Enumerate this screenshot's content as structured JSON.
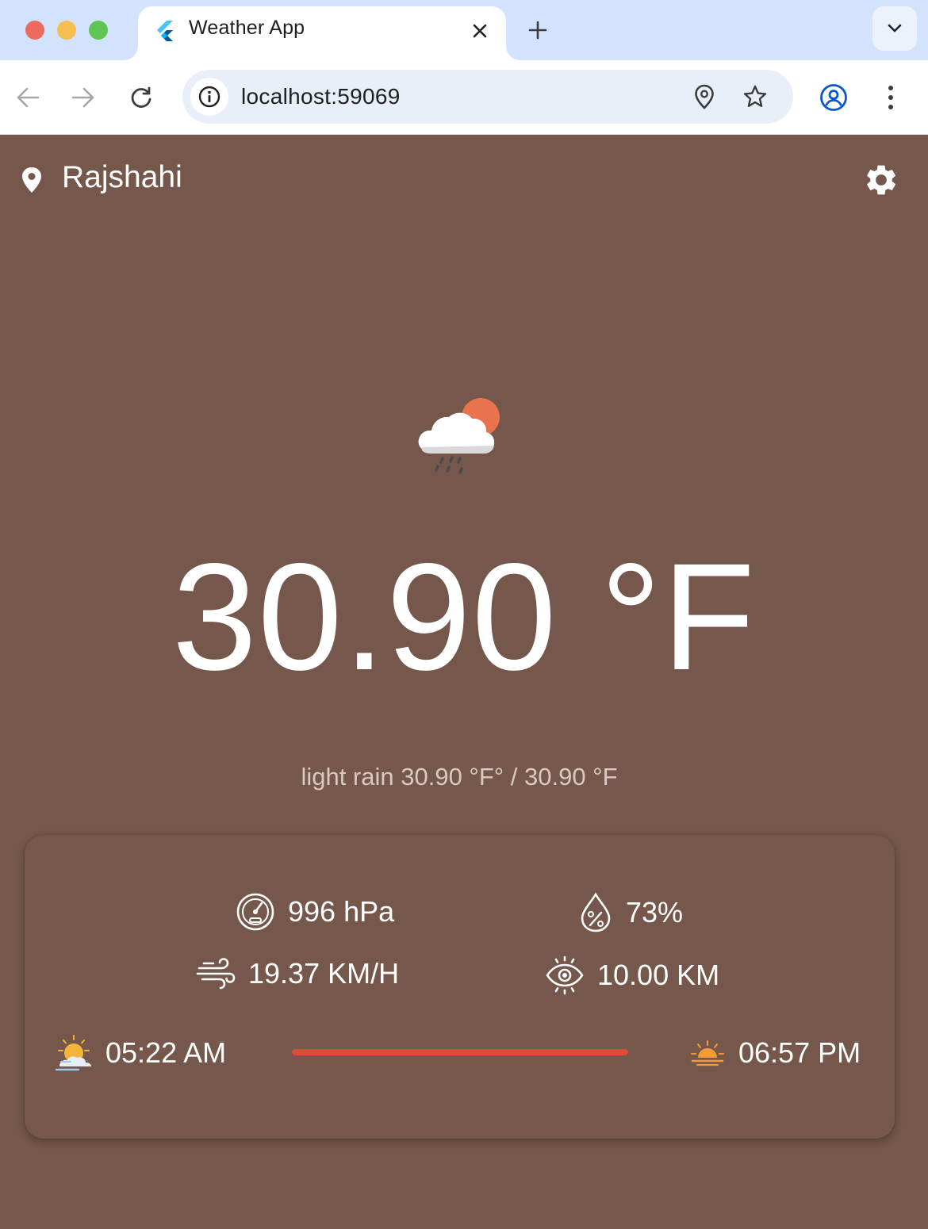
{
  "browser": {
    "tab_title": "Weather App",
    "url": "localhost:59069"
  },
  "header": {
    "city": "Rajshahi"
  },
  "weather": {
    "icon": "cloud-sun-rain-icon",
    "temperature": "30.90 °F",
    "description": "light rain 30.90 °F° / 30.90 °F"
  },
  "details": {
    "pressure": "996 hPa",
    "humidity": "73%",
    "wind": "19.37 KM/H",
    "visibility": "10.00 KM",
    "sunrise": "05:22 AM",
    "sunset": "06:57 PM"
  },
  "colors": {
    "background": "#75574b",
    "daylight_bar": "#de4c39",
    "sun": "#e9734f"
  }
}
